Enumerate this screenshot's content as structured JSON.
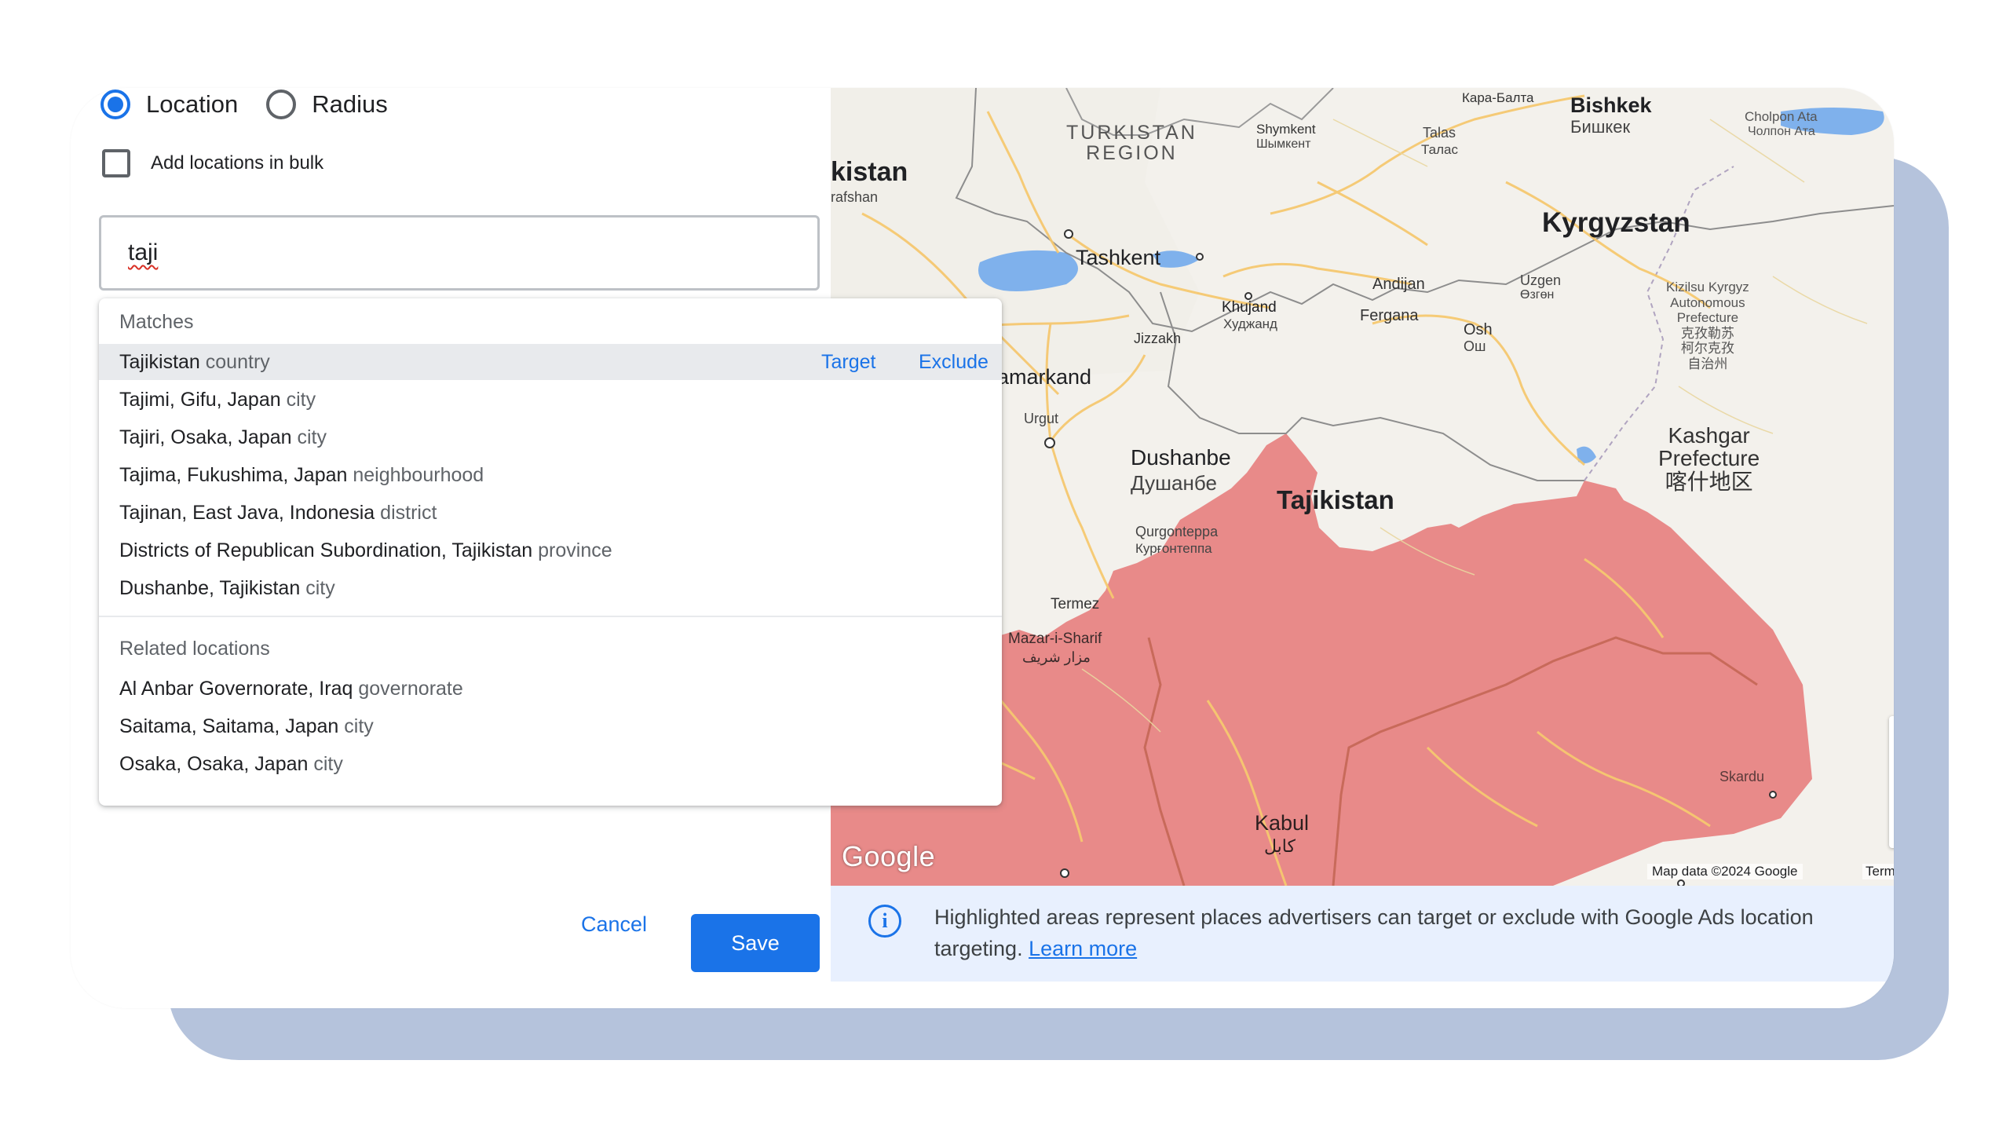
{
  "location_mode": {
    "options": [
      {
        "label": "Location",
        "selected": true
      },
      {
        "label": "Radius",
        "selected": false
      }
    ]
  },
  "bulk": {
    "label": "Add locations in bulk",
    "checked": false
  },
  "search": {
    "value": "taji"
  },
  "dropdown": {
    "matches_header": "Matches",
    "matches": [
      {
        "name": "Tajikistan",
        "type": "country",
        "highlighted": true
      },
      {
        "name": "Tajimi, Gifu, Japan",
        "type": "city"
      },
      {
        "name": "Tajiri, Osaka, Japan",
        "type": "city"
      },
      {
        "name": "Tajima, Fukushima, Japan",
        "type": "neighbourhood"
      },
      {
        "name": "Tajinan, East Java, Indonesia",
        "type": "district"
      },
      {
        "name": "Districts of Republican Subordination, Tajikistan",
        "type": "province"
      },
      {
        "name": "Dushanbe, Tajikistan",
        "type": "city"
      }
    ],
    "target_label": "Target",
    "exclude_label": "Exclude",
    "related_header": "Related locations",
    "related": [
      {
        "name": "Al Anbar Governorate, Iraq",
        "type": "governorate"
      },
      {
        "name": "Saitama, Saitama, Japan",
        "type": "city"
      },
      {
        "name": "Osaka, Osaka, Japan",
        "type": "city"
      }
    ]
  },
  "actions": {
    "cancel": "Cancel",
    "save": "Save"
  },
  "map": {
    "labels": {
      "kara_balta": "Кара-Балта",
      "bishkek": "Bishkek",
      "bishkek_cyr": "Бишкек",
      "cholpon_ata": "Cholpon Ata",
      "cholpon_ata_cyr": "Чолпон Ата",
      "turkistan_region": "TURKISTAN\nREGION",
      "shymkent": "Shymkent",
      "shymkent_cyr": "Шымкент",
      "talas": "Talas",
      "talas_cyr": "Талас",
      "kistan": "kistan",
      "rafshan": "rafshan",
      "kyrgyzstan": "Kyrgyzstan",
      "tashkent": "Tashkent",
      "andijan": "Andijan",
      "uzgen": "Uzgen",
      "uzgen_cyr": "Өзгөн",
      "kizilsu": "Kizilsu Kyrgyz\nAutonomous\nPrefecture\n克孜勒苏\n柯尔克孜\n自治州",
      "khujand": "Khujand",
      "khujand_cyr": "Худжанд",
      "fergana": "Fergana",
      "jizzakh": "Jizzakh",
      "osh": "Osh",
      "osh_cyr": "Ош",
      "samarkand": "amarkand",
      "urgut": "Urgut",
      "kashgar": "Kashgar\nPrefecture\n喀什地区",
      "dushanbe": "Dushanbe",
      "dushanbe_cyr": "Душанбе",
      "tajikistan": "Tajikistan",
      "qurgonteppa": "Qurgonteppa",
      "qurgonteppa_cyr": "Курғонтеппа",
      "termez": "Termez",
      "mazar": "Mazar-i-Sharif",
      "mazar_ar": "مزار شریف",
      "skardu": "Skardu",
      "kabul": "Kabul",
      "kabul_ar": "کابل"
    },
    "zoom_in": "+",
    "zoom_out": "−",
    "google": "Google",
    "map_data": "Map data ©2024 Google",
    "terms": "Terms",
    "highlight_color": "#e57373"
  },
  "info": {
    "text": "Highlighted areas represent places advertisers can target or exclude with Google Ads location targeting.",
    "link": "Learn more"
  }
}
